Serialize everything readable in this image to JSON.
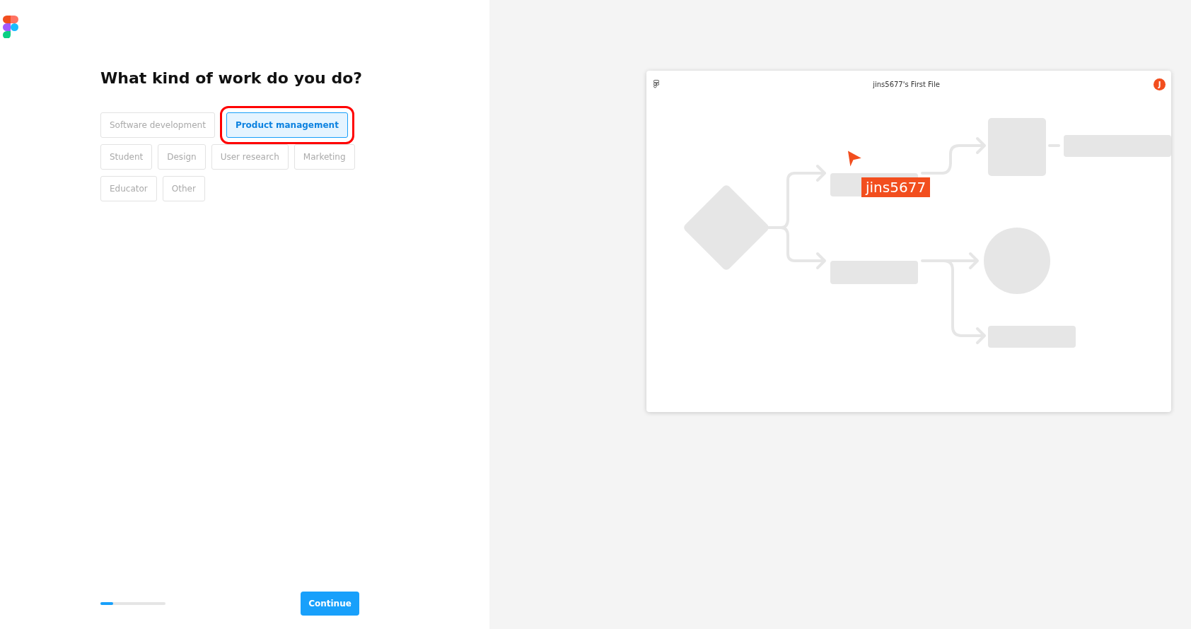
{
  "question": {
    "title": "What kind of work do you do?"
  },
  "options": [
    {
      "label": "Software development",
      "selected": false
    },
    {
      "label": "Product management",
      "selected": true
    },
    {
      "label": "Student",
      "selected": false
    },
    {
      "label": "Design",
      "selected": false
    },
    {
      "label": "User research",
      "selected": false
    },
    {
      "label": "Marketing",
      "selected": false
    },
    {
      "label": "Educator",
      "selected": false
    },
    {
      "label": "Other",
      "selected": false
    }
  ],
  "progress": {
    "level": 0.2
  },
  "continue_button": "Continue",
  "preview": {
    "file_title": "jins5677's First File",
    "avatar": "J",
    "cursor_label": "jins5677"
  }
}
